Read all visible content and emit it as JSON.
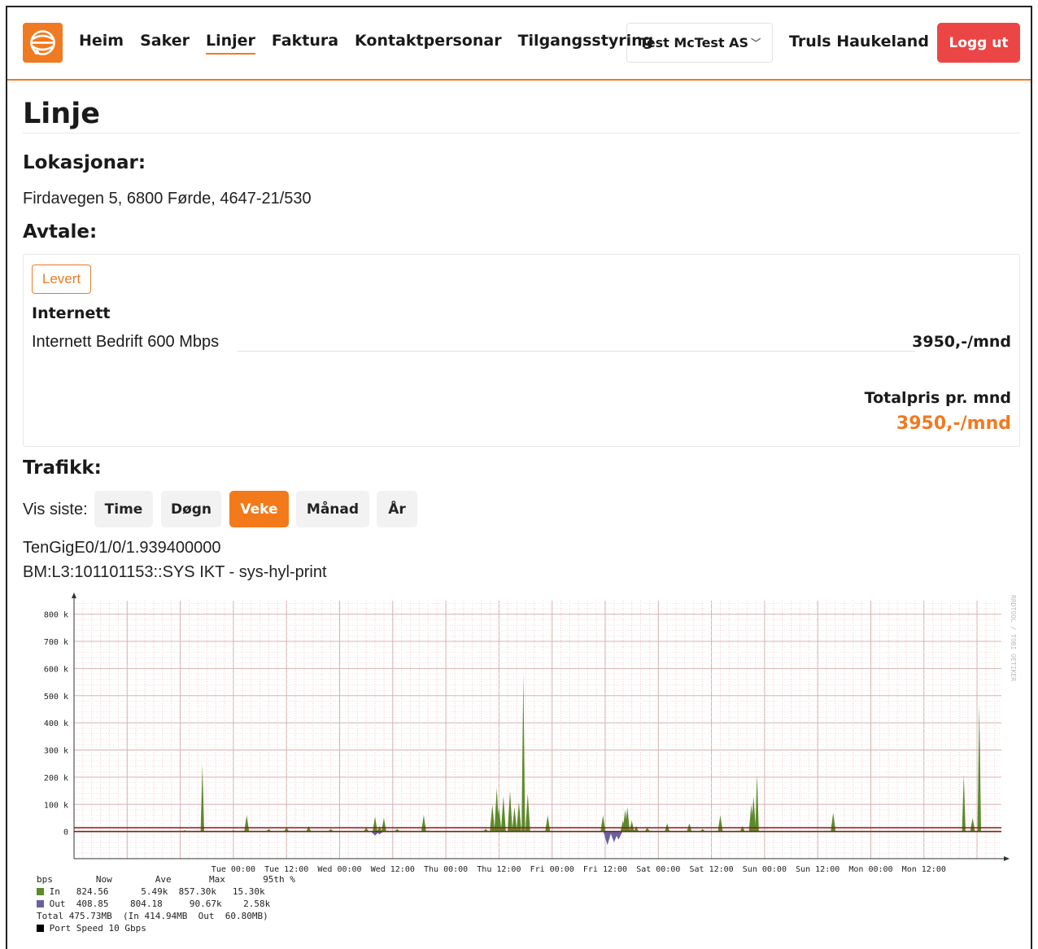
{
  "nav": {
    "items": [
      {
        "label": "Heim",
        "active": false
      },
      {
        "label": "Saker",
        "active": false
      },
      {
        "label": "Linjer",
        "active": true
      },
      {
        "label": "Faktura",
        "active": false
      },
      {
        "label": "Kontaktpersonar",
        "active": false
      },
      {
        "label": "Tilgangsstyring",
        "active": false
      }
    ],
    "org": "Test McTest AS",
    "user": "Truls Haukeland",
    "logout": "Logg ut"
  },
  "page": {
    "title": "Linje",
    "locations_heading": "Lokasjonar:",
    "location": "Firdavegen 5, 6800 Førde, 4647-21/530",
    "agreement_heading": "Avtale:",
    "status_badge": "Levert",
    "product_group": "Internett",
    "product": "Internett Bedrift 600 Mbps",
    "product_price": "3950,-/mnd",
    "total_label": "Totalpris pr. mnd",
    "total_value": "3950,-/mnd",
    "traffic_heading": "Trafikk:",
    "show_last_label": "Vis siste:",
    "periods": [
      {
        "label": "Time",
        "active": false
      },
      {
        "label": "Døgn",
        "active": false
      },
      {
        "label": "Veke",
        "active": true
      },
      {
        "label": "Månad",
        "active": false
      },
      {
        "label": "År",
        "active": false
      }
    ],
    "interface": "TenGigE0/1/0/1.939400000",
    "description": "BM:L3:101101153::SYS IKT - sys-hyl-print"
  },
  "colors": {
    "accent": "#f07a21",
    "logout": "#ec4545",
    "in": "#5c8a2a",
    "out": "#6a5fa5",
    "limit": "#8b1a1a"
  },
  "chart_data": {
    "type": "area",
    "ylabel_unit": "",
    "y_ticks": [
      "0",
      "100 k",
      "200 k",
      "300 k",
      "400 k",
      "500 k",
      "600 k",
      "700 k",
      "800 k"
    ],
    "x_ticks": [
      "Tue 00:00",
      "Tue 12:00",
      "Wed 00:00",
      "Wed 12:00",
      "Thu 00:00",
      "Thu 12:00",
      "Fri 00:00",
      "Fri 12:00",
      "Sat 00:00",
      "Sat 12:00",
      "Sun 00:00",
      "Sun 12:00",
      "Mon 00:00",
      "Mon 12:00"
    ],
    "ylim": [
      -100,
      850
    ],
    "side_label": "RRDTOOL / TOBI OETIKER",
    "series": [
      {
        "name": "In",
        "peaks_hours": [
          [
            -11,
            5
          ],
          [
            -7,
            245
          ],
          [
            0,
            5
          ],
          [
            3,
            60
          ],
          [
            8,
            10
          ],
          [
            12,
            15
          ],
          [
            17,
            20
          ],
          [
            22,
            10
          ],
          [
            30,
            15
          ],
          [
            32,
            55
          ],
          [
            33,
            20
          ],
          [
            34,
            50
          ],
          [
            37,
            10
          ],
          [
            43,
            60
          ],
          [
            57,
            10
          ],
          [
            58.5,
            100
          ],
          [
            59.5,
            160
          ],
          [
            60,
            90
          ],
          [
            61,
            130
          ],
          [
            62.5,
            150
          ],
          [
            63.5,
            90
          ],
          [
            64.5,
            110
          ],
          [
            65.5,
            580
          ],
          [
            66.5,
            140
          ],
          [
            71,
            60
          ],
          [
            83.5,
            60
          ],
          [
            88,
            40
          ],
          [
            88.5,
            80
          ],
          [
            89,
            90
          ],
          [
            90,
            40
          ],
          [
            91,
            20
          ],
          [
            93.5,
            15
          ],
          [
            98,
            30
          ],
          [
            103,
            30
          ],
          [
            106,
            10
          ],
          [
            110,
            60
          ],
          [
            115,
            20
          ],
          [
            117,
            100
          ],
          [
            117.5,
            130
          ],
          [
            118.3,
            210
          ],
          [
            135.5,
            70
          ],
          [
            165,
            210
          ],
          [
            167,
            50
          ],
          [
            168.5,
            470
          ]
        ]
      },
      {
        "name": "Out",
        "dips_hours": [
          [
            32,
            -15
          ],
          [
            33,
            -10
          ],
          [
            84.5,
            -50
          ],
          [
            86,
            -40
          ],
          [
            87,
            -30
          ]
        ]
      },
      {
        "name": "Port Speed"
      }
    ],
    "legend_header": {
      "unit": "bps",
      "cols": [
        "Now",
        "Ave",
        "Max",
        "95th %"
      ]
    },
    "legend_rows": [
      {
        "name": "In",
        "now": "824.56",
        "ave": "5.49k",
        "max": "857.30k",
        "p95": "15.30k"
      },
      {
        "name": "Out",
        "now": "408.85",
        "ave": "804.18",
        "max": "90.67k",
        "p95": "2.58k"
      }
    ],
    "legend_total": "Total 475.73MB  (In 414.94MB  Out  60.80MB)",
    "legend_port": "Port Speed 10 Gbps"
  }
}
